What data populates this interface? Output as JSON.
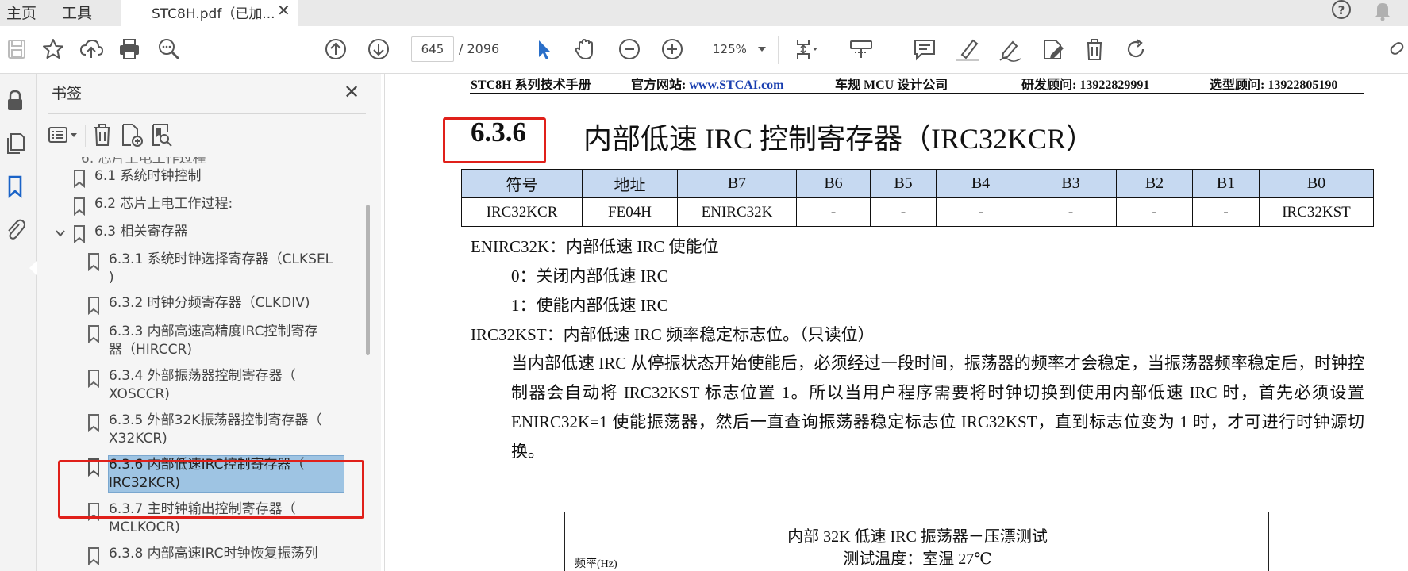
{
  "tabs": {
    "home": "主页",
    "tools": "工具",
    "document": "STC8H.pdf（已加...",
    "close": "✕"
  },
  "toolbar": {
    "current_page": "645",
    "total_pages": "/ 2096",
    "zoom": "125%",
    "icons": [
      "save-icon",
      "star-icon",
      "cloud-upload-icon",
      "print-icon",
      "search-zoom-icon",
      "page-up-icon",
      "page-down-icon",
      "select-cursor-icon",
      "hand-icon",
      "zoom-out-icon",
      "zoom-in-icon",
      "page-fit-icon",
      "marquee-icon",
      "comment-icon",
      "highlight-icon",
      "sign-icon",
      "edit-icon",
      "delete-icon",
      "rotate-icon"
    ]
  },
  "bookmarks": {
    "title": "书签",
    "close": "✕",
    "items": [
      {
        "label": "6.1 系统时钟控制",
        "level": 1
      },
      {
        "label": "6.2  芯片上电工作过程:",
        "level": 1
      },
      {
        "label": "6.3  相关寄存器",
        "level": 1,
        "expanded": true
      },
      {
        "label": "6.3.1  系统时钟选择寄存器（CLKSEL",
        "label2": ")",
        "level": 2
      },
      {
        "label": "6.3.2 时钟分频寄存器（CLKDIV)",
        "level": 2
      },
      {
        "label": "6.3.3  内部高速高精度IRC控制寄存",
        "label2": "器（HIRCCR)",
        "level": 2
      },
      {
        "label": "6.3.4 外部振荡器控制寄存器（",
        "label2": "XOSCCR)",
        "level": 2
      },
      {
        "label": "6.3.5 外部32K振荡器控制寄存器（",
        "label2": "X32KCR)",
        "level": 2
      },
      {
        "label": "6.3.6  内部低速IRC控制寄存器（",
        "label2": "IRC32KCR)",
        "level": 2,
        "selected": true
      },
      {
        "label": "6.3.7  主时钟输出控制寄存器（",
        "label2": "MCLKOCR)",
        "level": 2
      },
      {
        "label": "6.3.8  内部高速IRC时钟恢复振荡列",
        "level": 2
      }
    ]
  },
  "doc": {
    "header": {
      "manual": "STC8H 系列技术手册",
      "site_label": "官方网站: ",
      "site_link": "www.STCAI.com",
      "company": "车规 MCU 设计公司",
      "rd": "研发顾问: 13922829991",
      "sel": "选型顾问: 13922805190"
    },
    "section_number": "6.3.6",
    "section_title": "内部低速 IRC 控制寄存器（IRC32KCR）",
    "table": {
      "headers": [
        "符号",
        "地址",
        "B7",
        "B6",
        "B5",
        "B4",
        "B3",
        "B2",
        "B1",
        "B0"
      ],
      "row": [
        "IRC32KCR",
        "FE04H",
        "ENIRC32K",
        "-",
        "-",
        "-",
        "-",
        "-",
        "-",
        "IRC32KST"
      ]
    },
    "enirc_title": "ENIRC32K：内部低速 IRC 使能位",
    "enirc_0": "0：关闭内部低速 IRC",
    "enirc_1": "1：使能内部低速 IRC",
    "irckst_title": "IRC32KST：内部低速 IRC 频率稳定标志位。（只读位）",
    "irckst_para": "当内部低速 IRC 从停振状态开始使能后，必须经过一段时间，振荡器的频率才会稳定，当振荡器频率稳定后，时钟控制器会自动将 IRC32KST 标志位置 1。所以当用户程序需要将时钟切换到使用内部低速 IRC 时，首先必须设置 ENIRC32K=1 使能振荡器，然后一直查询振荡器稳定标志位 IRC32KST，直到标志位变为 1 时，才可进行时钟源切换。",
    "chart_title": "内部 32K 低速 IRC 振荡器－压漂测试",
    "chart_subtitle": "测试温度：室温 27℃",
    "chart_ylabel": "频率(Hz)"
  }
}
